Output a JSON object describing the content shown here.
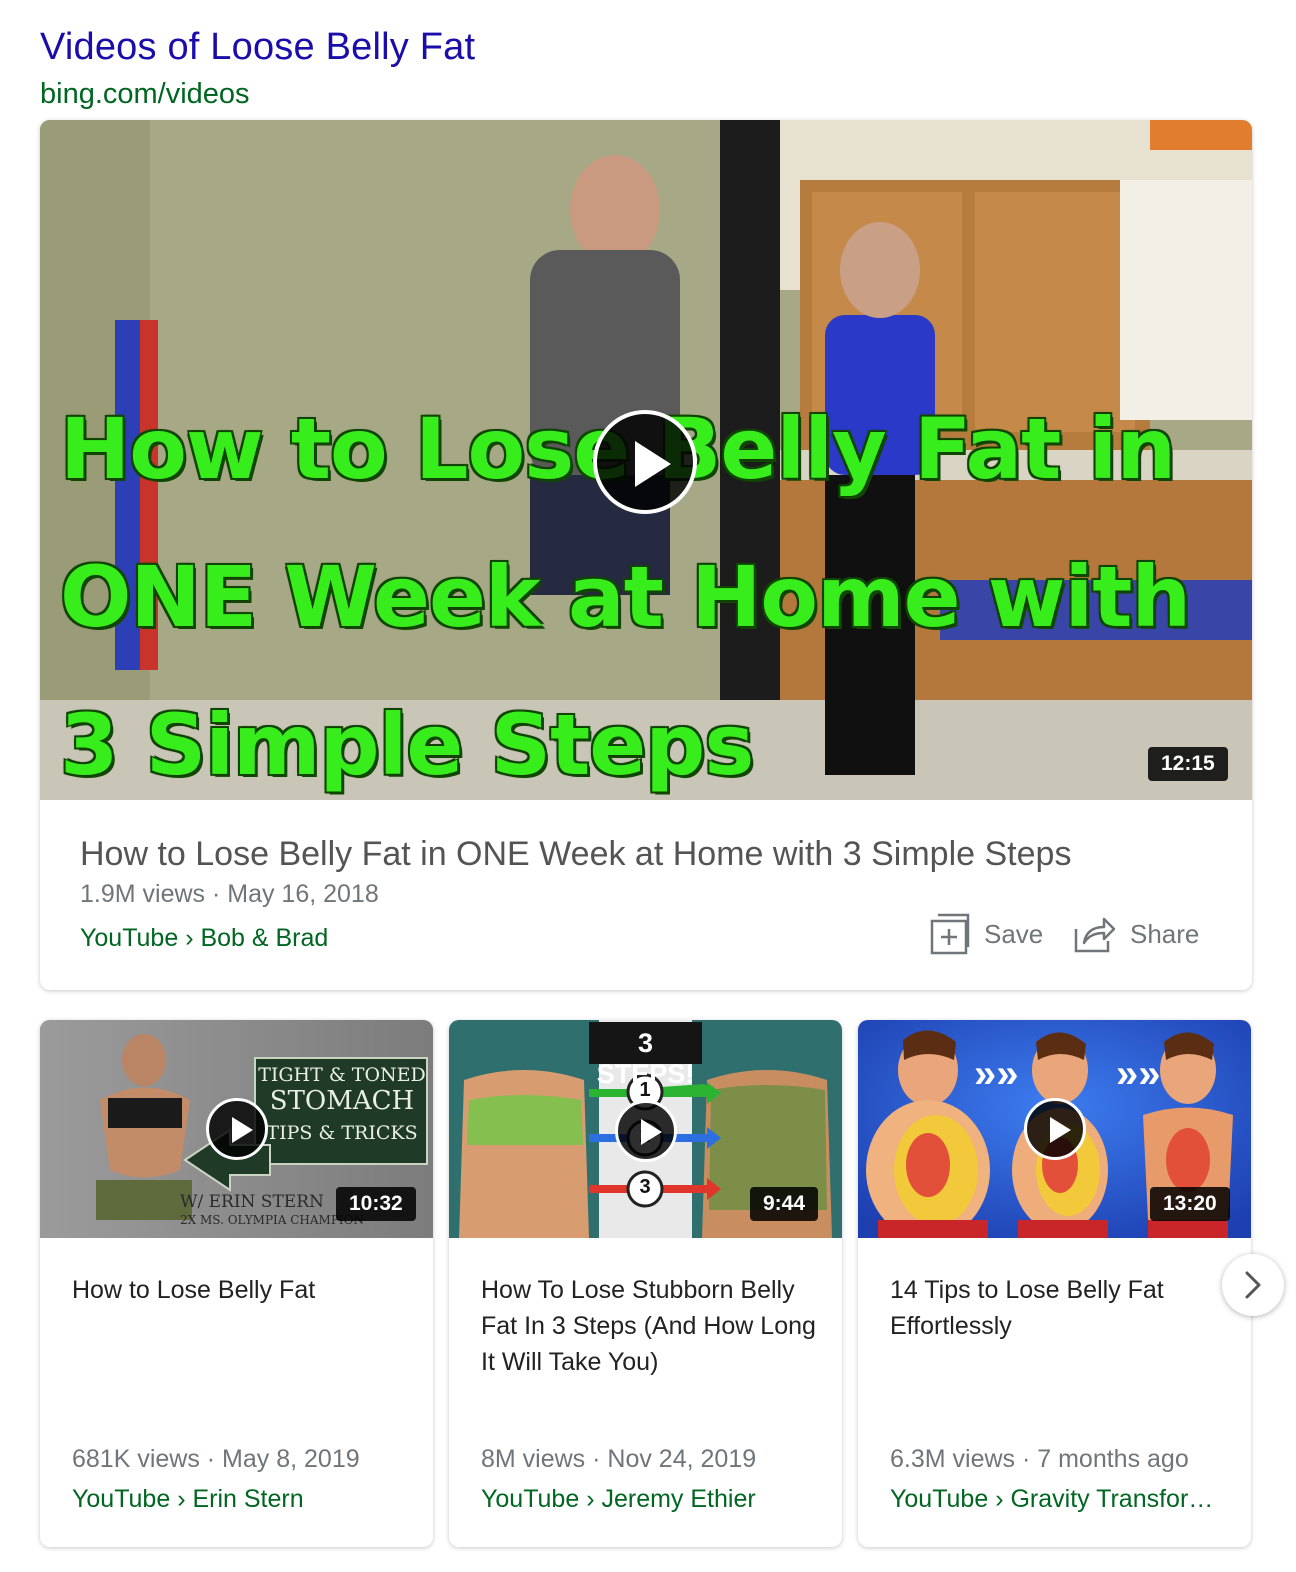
{
  "header": {
    "title": "Videos of Loose Belly Fat",
    "url": "bing.com/videos"
  },
  "featured": {
    "thumbnail_text": [
      "How to Lose Belly Fat in",
      "ONE Week at Home with",
      "3 Simple Steps"
    ],
    "duration": "12:15",
    "title": "How to Lose Belly Fat in ONE Week at Home with 3 Simple Steps",
    "meta": "1.9M views · May 16, 2018",
    "source": "YouTube › Bob & Brad",
    "actions": {
      "save": "Save",
      "share": "Share"
    }
  },
  "videos": [
    {
      "thumbnail_text": [
        "TIGHT & TONED",
        "STOMACH",
        "TIPS & TRICKS",
        "W/ ERIN STERN",
        "2X MS. OLYMPIA CHAMPION"
      ],
      "duration": "10:32",
      "title": "How to Lose Belly Fat",
      "meta": "681K views · May 8, 2019",
      "source": "YouTube › Erin Stern"
    },
    {
      "thumbnail_text": [
        "3 STEPS!",
        "1",
        "2",
        "3"
      ],
      "duration": "9:44",
      "title": "How To Lose Stubborn Belly Fat In 3 Steps (And How Long It Will Take You)",
      "meta": "8M views · Nov 24, 2019",
      "source": "YouTube › Jeremy Ethier"
    },
    {
      "thumbnail_text": [
        "»»",
        "»»"
      ],
      "duration": "13:20",
      "title": "14 Tips to Lose Belly Fat Effortlessly",
      "meta": "6.3M views · 7 months ago",
      "source": "YouTube › Gravity Transfor…"
    }
  ],
  "icons": {
    "play": "play-icon",
    "save": "add-box-icon",
    "share": "share-arrow-icon",
    "next": "chevron-right-icon"
  },
  "colors": {
    "link_title": "#1a0dab",
    "url_green": "#006621",
    "thumbnail_text_green": "#37ee1c",
    "meta_gray": "#70757a"
  }
}
